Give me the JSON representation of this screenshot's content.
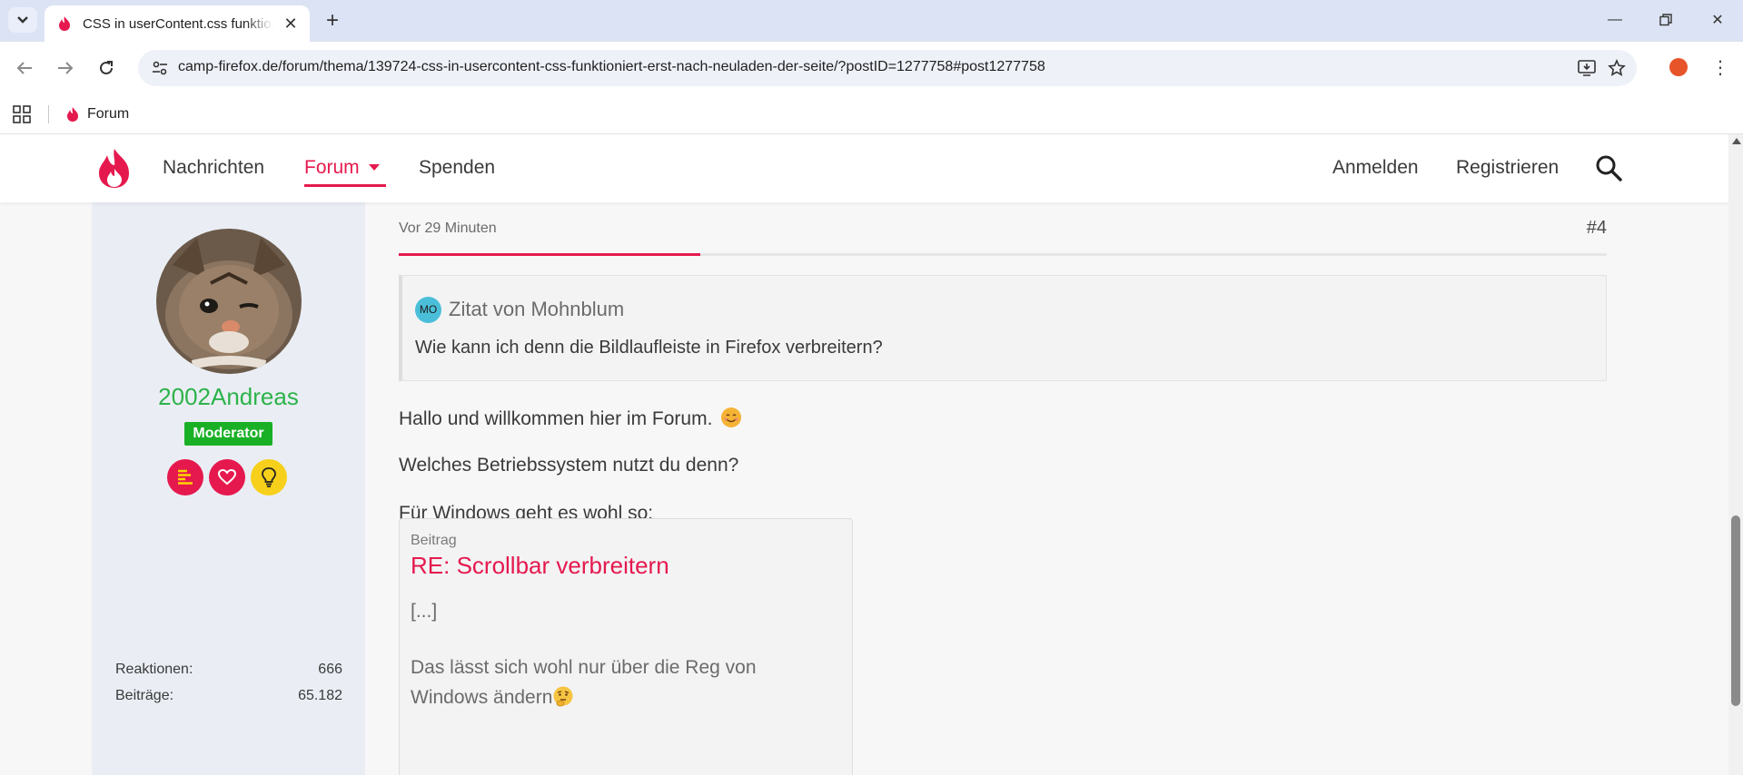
{
  "browser": {
    "tab_title": "CSS in userContent.css funktioniert erst nach Neuladen der Seite",
    "url": "camp-firefox.de/forum/thema/139724-css-in-usercontent-css-funktioniert-erst-nach-neuladen-der-seite/?postID=1277758#post1277758",
    "bookmark_label": "Forum"
  },
  "site_nav": {
    "links": [
      "Nachrichten",
      "Forum",
      "Spenden"
    ],
    "login": "Anmelden",
    "register": "Registrieren"
  },
  "author": {
    "name": "2002Andreas",
    "role": "Moderator",
    "stats": [
      {
        "label": "Reaktionen:",
        "value": "666"
      },
      {
        "label": "Beiträge:",
        "value": "65.182"
      }
    ]
  },
  "post": {
    "time": "Vor 29 Minuten",
    "number": "#4",
    "quote_avatar": "MO",
    "quote_author": "Zitat von Mohnblum",
    "quote_text": "Wie kann ich denn die Bildlaufleiste in Firefox verbreitern?",
    "paragraphs": [
      "Hallo und willkommen hier im Forum.",
      "Welches Betriebssystem nutzt du denn?",
      "Für Windows geht es wohl so:"
    ],
    "embed": {
      "label": "Beitrag",
      "title": "RE: Scrollbar verbreitern",
      "ellipsis": "[...]",
      "text_line1": "Das lässt sich wohl nur über die Reg von",
      "text_line2": "Windows ändern"
    }
  },
  "colors": {
    "accent": "#e5194e",
    "username": "#2db34a",
    "moderator_badge": "#19b026"
  }
}
